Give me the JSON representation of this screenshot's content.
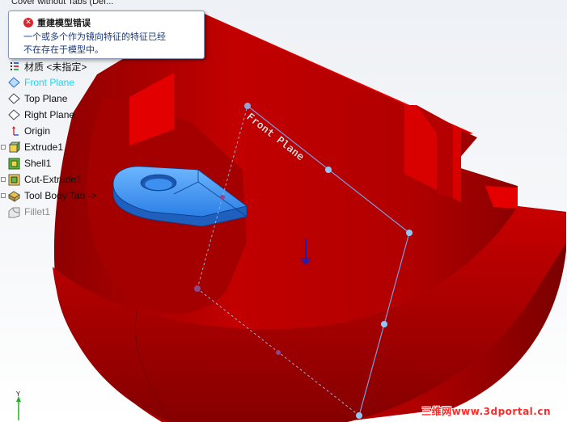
{
  "tree": {
    "root_label": "Cover without Tabs  (Def...",
    "items": [
      {
        "label": "材质 <未指定>",
        "icon": "material-icon"
      },
      {
        "label": "Front Plane",
        "icon": "plane-icon",
        "active": true
      },
      {
        "label": "Top Plane",
        "icon": "plane-icon"
      },
      {
        "label": "Right Plane",
        "icon": "plane-icon"
      },
      {
        "label": "Origin",
        "icon": "origin-icon"
      },
      {
        "label": "Extrude1",
        "icon": "extrude-icon"
      },
      {
        "label": "Shell1",
        "icon": "shell-icon"
      },
      {
        "label": "Cut-Extrude1",
        "icon": "cut-extrude-icon"
      },
      {
        "label": "Tool Body Tab ->",
        "icon": "tool-body-icon"
      },
      {
        "label": "Fillet1",
        "icon": "fillet-icon",
        "dim": true
      }
    ]
  },
  "error_tip": {
    "title": "重建模型错误",
    "line1": "一个或多个作为镜向特征的特征已经",
    "line2": "不在存在于模型中。"
  },
  "viewport": {
    "plane_label": "Front Plane",
    "axis_label": "Y"
  },
  "watermark": "三维网www.3dportal.cn",
  "colors": {
    "part_red": "#cc0000",
    "tab_blue": "#2a7fe8",
    "plane_blue": "#6a8fd0",
    "active_tree": "#22d3f0",
    "watermark": "#ff2a2a"
  }
}
